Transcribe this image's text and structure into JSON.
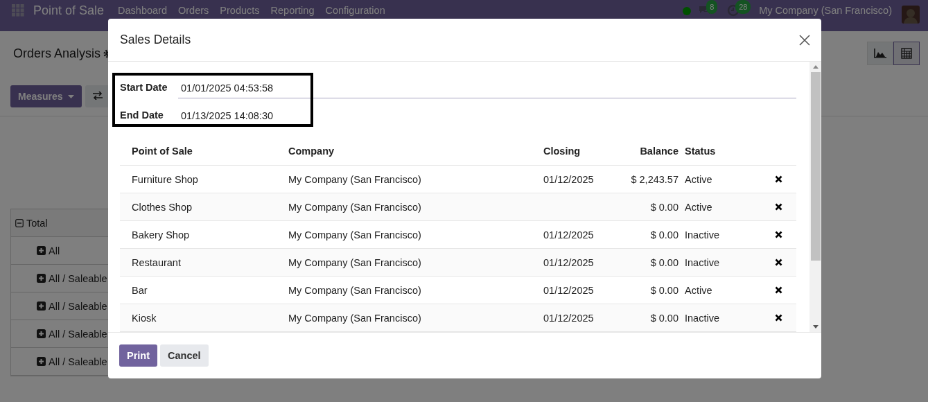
{
  "navbar": {
    "app_name": "Point of Sale",
    "menu": [
      "Dashboard",
      "Orders",
      "Products",
      "Reporting",
      "Configuration"
    ],
    "notifications": [
      {
        "kind": "chat",
        "count": "8"
      },
      {
        "kind": "activity",
        "count": "28"
      }
    ],
    "company": "My Company (San Francisco)"
  },
  "control_panel": {
    "title": "Orders Analysis",
    "measures": "Measures",
    "views": [
      {
        "kind": "graph",
        "selected": false
      },
      {
        "kind": "pivot",
        "selected": true
      }
    ]
  },
  "pivot": {
    "header": "Total",
    "rows": [
      "All",
      "All / Saleable",
      "All / Saleable",
      "All / Saleable",
      "All / Saleable"
    ]
  },
  "dialog": {
    "title": "Sales Details",
    "fields": [
      {
        "label": "Start Date",
        "value": "01/01/2025 04:53:58",
        "focused": true
      },
      {
        "label": "End Date",
        "value": "01/13/2025 14:08:30",
        "focused": false
      }
    ],
    "columns": [
      "Point of Sale",
      "Company",
      "Closing",
      "Balance",
      "Status"
    ],
    "rows": [
      {
        "pos": "Furniture Shop",
        "company": "My Company (San Francisco)",
        "closing": "01/12/2025",
        "balance": "$ 2,243.57",
        "status": "Active"
      },
      {
        "pos": "Clothes Shop",
        "company": "My Company (San Francisco)",
        "closing": "",
        "balance": "$ 0.00",
        "status": "Active"
      },
      {
        "pos": "Bakery Shop",
        "company": "My Company (San Francisco)",
        "closing": "01/12/2025",
        "balance": "$ 0.00",
        "status": "Inactive"
      },
      {
        "pos": "Restaurant",
        "company": "My Company (San Francisco)",
        "closing": "01/12/2025",
        "balance": "$ 0.00",
        "status": "Inactive"
      },
      {
        "pos": "Bar",
        "company": "My Company (San Francisco)",
        "closing": "01/12/2025",
        "balance": "$ 0.00",
        "status": "Active"
      },
      {
        "pos": "Kiosk",
        "company": "My Company (San Francisco)",
        "closing": "01/12/2025",
        "balance": "$ 0.00",
        "status": "Inactive"
      }
    ],
    "buttons": [
      {
        "kind": "primary",
        "label": "Print"
      },
      {
        "kind": "secondary",
        "label": "Cancel"
      }
    ]
  }
}
